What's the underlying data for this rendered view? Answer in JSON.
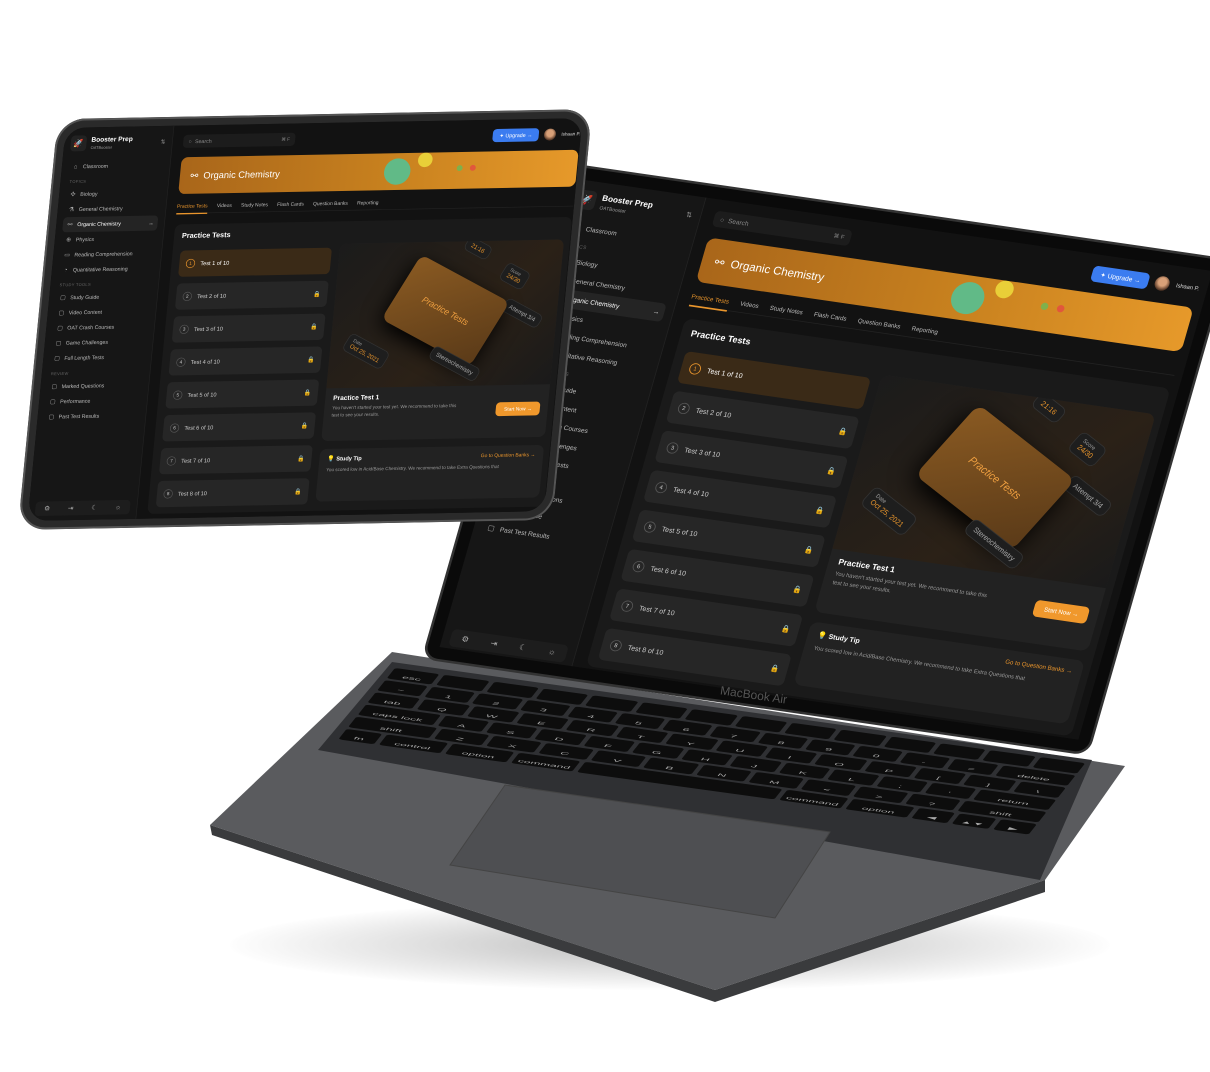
{
  "app": {
    "name": "Booster Prep",
    "subtitle": "OATBooster"
  },
  "sidebar": {
    "classroom": "Classroom",
    "topics_label": "TOPICS",
    "topics": [
      {
        "label": "Biology",
        "icon": "dna-icon"
      },
      {
        "label": "General Chemistry",
        "icon": "flask-icon"
      },
      {
        "label": "Organic Chemistry",
        "icon": "molecule-icon",
        "active": true
      },
      {
        "label": "Physics",
        "icon": "globe-icon"
      },
      {
        "label": "Reading Comprehension",
        "icon": "book-icon"
      },
      {
        "label": "Quantitative Reasoning",
        "icon": "chart-icon"
      }
    ],
    "study_tools_label": "STUDY TOOLS",
    "study_tools": [
      {
        "label": "Study Guide"
      },
      {
        "label": "Video Content"
      },
      {
        "label": "OAT Crash Courses"
      },
      {
        "label": "Game Challenges"
      },
      {
        "label": "Full Length Tests"
      }
    ],
    "review_label": "REVIEW",
    "review": [
      {
        "label": "Marked Questions"
      },
      {
        "label": "Performance"
      },
      {
        "label": "Past Test Results"
      }
    ]
  },
  "topbar": {
    "search_placeholder": "Search",
    "shortcut": "⌘ F",
    "upgrade": "Upgrade →",
    "user": "Ishaan P."
  },
  "banner": {
    "title": "Organic Chemistry"
  },
  "tabs": [
    "Practice Tests",
    "Videos",
    "Study Notes",
    "Flash Cards",
    "Question Banks",
    "Reporting"
  ],
  "practice": {
    "title": "Practice Tests",
    "tests": [
      "Test 1 of 10",
      "Test 2 of 10",
      "Test 3 of 10",
      "Test 4 of 10",
      "Test 5 of 10",
      "Test 6 of 10",
      "Test 7 of 10",
      "Test 8 of 10"
    ],
    "art": {
      "card": "Practice Tests",
      "date_label": "Date",
      "date": "Oct 25, 2021",
      "score_label": "Score",
      "score": "24/30",
      "time": "21:16",
      "attempt": "Attempt 3/4",
      "topic": "Stereochemistry"
    },
    "selected_title": "Practice Test 1",
    "selected_desc": "You haven't started your test yet. We recommend to take this test to see your results.",
    "start": "Start Now →"
  },
  "tip": {
    "title": "Study Tip",
    "link": "Go to Question Banks →",
    "text": "You scored low in Acid/Base Chemistry. We recommend to take Extra Questions that"
  },
  "laptop_label": "MacBook Air",
  "keyboard": [
    [
      "esc",
      "",
      "",
      "",
      "",
      "",
      "",
      "",
      "",
      "",
      "",
      "",
      "",
      ""
    ],
    [
      "~",
      "1",
      "2",
      "3",
      "4",
      "5",
      "6",
      "7",
      "8",
      "9",
      "0",
      "-",
      "=",
      "delete"
    ],
    [
      "tab",
      "Q",
      "W",
      "E",
      "R",
      "T",
      "Y",
      "U",
      "I",
      "O",
      "P",
      "[",
      "]",
      "\\"
    ],
    [
      "caps lock",
      "A",
      "S",
      "D",
      "F",
      "G",
      "H",
      "J",
      "K",
      "L",
      ";",
      "'",
      "return"
    ],
    [
      "shift",
      "Z",
      "X",
      "C",
      "V",
      "B",
      "N",
      "M",
      "<",
      ">",
      "?",
      "shift"
    ],
    [
      "fn",
      "control",
      "option",
      "command",
      "",
      "command",
      "option",
      "◀",
      "▲▼",
      "▶"
    ]
  ],
  "colors": {
    "accent": "#e9952c",
    "upgrade": "#3b7cf0",
    "background": "#121212"
  }
}
